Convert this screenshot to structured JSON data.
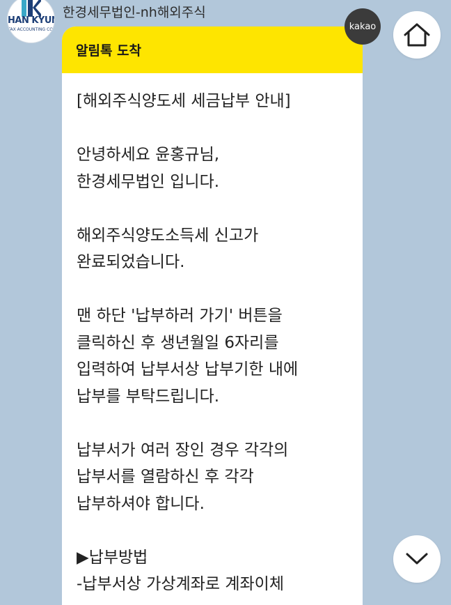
{
  "header": {
    "sender_name": "한경세무법인-nh해외주식",
    "avatar_brand": "HAN KYUNG",
    "avatar_sub": "TAX ACCOUNTING CO."
  },
  "badge": {
    "label": "kakao"
  },
  "message": {
    "header_title": "알림톡 도착",
    "lines": [
      "[해외주식양도세 세금납부 안내]",
      "",
      "안녕하세요 윤홍규님,",
      "한경세무법인 입니다.",
      "",
      "해외주식양도소득세 신고가",
      "완료되었습니다.",
      "",
      "맨 하단 '납부하러 가기' 버튼을",
      "클릭하신 후 생년월일 6자리를",
      "입력하여 납부서상 납부기한 내에",
      "납부를 부탁드립니다.",
      "",
      "납부서가 여러 장인 경우 각각의",
      "납부서를 열람하신 후 각각",
      "납부하셔야 합니다.",
      "",
      "▶납부방법",
      "-납부서상 가상계좌로 계좌이체"
    ]
  },
  "colors": {
    "background": "#b2c7da",
    "header_yellow": "#fee500",
    "brand_blue": "#1d3f77",
    "brand_teal": "#3aa8c8"
  },
  "icons": {
    "home": "home-icon",
    "scroll_down": "chevron-down-icon"
  }
}
